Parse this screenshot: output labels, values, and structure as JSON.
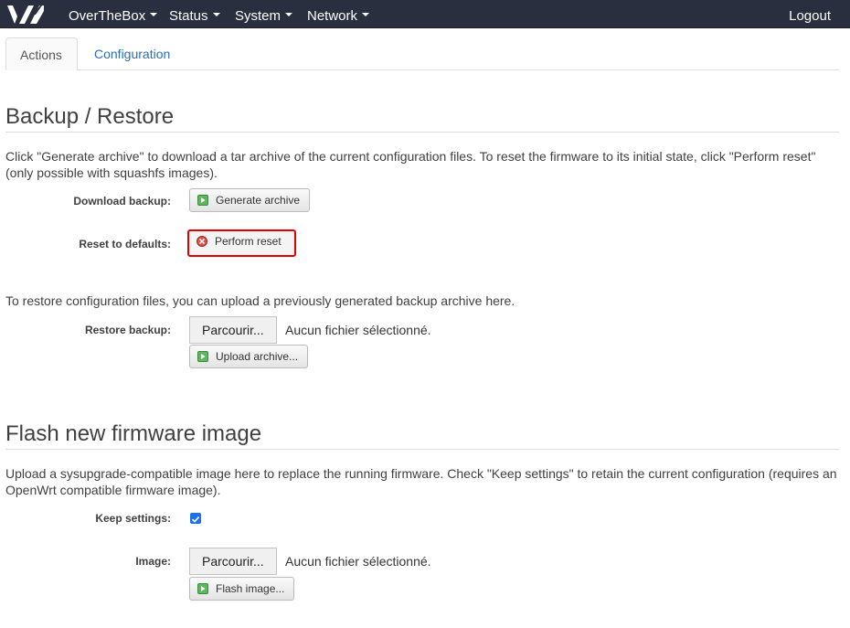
{
  "navbar": {
    "logo": "ovh-logo",
    "menus": [
      "OverTheBox",
      "Status",
      "System",
      "Network"
    ],
    "logout": "Logout"
  },
  "tabs": {
    "actions": "Actions",
    "configuration": "Configuration"
  },
  "backup": {
    "title": "Backup / Restore",
    "description": "Click \"Generate archive\" to download a tar archive of the current configuration files. To reset the firmware to its initial state, click \"Perform reset\" (only possible with squashfs images).",
    "download_label": "Download backup:",
    "generate_button": "Generate archive",
    "reset_label": "Reset to defaults:",
    "reset_button": "Perform reset",
    "restore_description": "To restore configuration files, you can upload a previously generated backup archive here.",
    "restore_label": "Restore backup:",
    "browse_button": "Parcourir...",
    "file_status": "Aucun fichier sélectionné.",
    "upload_button": "Upload archive..."
  },
  "flash": {
    "title": "Flash new firmware image",
    "description": "Upload a sysupgrade-compatible image here to replace the running firmware. Check \"Keep settings\" to retain the current configuration (requires an OpenWrt compatible firmware image).",
    "keep_label": "Keep settings:",
    "keep_checked": true,
    "image_label": "Image:",
    "browse_button": "Parcourir...",
    "file_status": "Aucun fichier sélectionné.",
    "flash_button": "Flash image..."
  },
  "icons": {
    "apply": "green-apply-icon",
    "reset": "red-reset-icon"
  },
  "colors": {
    "navbar": "#2a2f3f",
    "link": "#2a6ebb",
    "reset_border": "#e00000",
    "checkbox": "#1a73e8"
  }
}
